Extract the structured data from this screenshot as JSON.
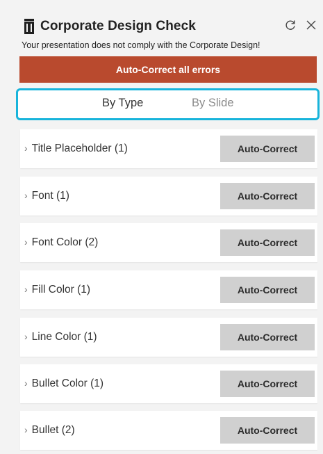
{
  "header": {
    "title": "Corporate Design Check",
    "subtitle": "Your presentation does not comply with the Corporate Design!",
    "refresh_icon": "refresh-icon",
    "close_icon": "close-icon"
  },
  "primary_action": {
    "label": "Auto-Correct all errors",
    "color": "#b94a2e"
  },
  "tabs": [
    {
      "label": "By Type",
      "active": true
    },
    {
      "label": "By Slide",
      "active": false
    }
  ],
  "tab_highlight_color": "#18b4db",
  "rows": [
    {
      "label": "Title Placeholder (1)",
      "button": "Auto-Correct"
    },
    {
      "label": "Font (1)",
      "button": "Auto-Correct"
    },
    {
      "label": "Font Color (2)",
      "button": "Auto-Correct"
    },
    {
      "label": "Fill Color (1)",
      "button": "Auto-Correct"
    },
    {
      "label": "Line Color (1)",
      "button": "Auto-Correct"
    },
    {
      "label": "Bullet Color (1)",
      "button": "Auto-Correct"
    },
    {
      "label": "Bullet (2)",
      "button": "Auto-Correct"
    }
  ]
}
